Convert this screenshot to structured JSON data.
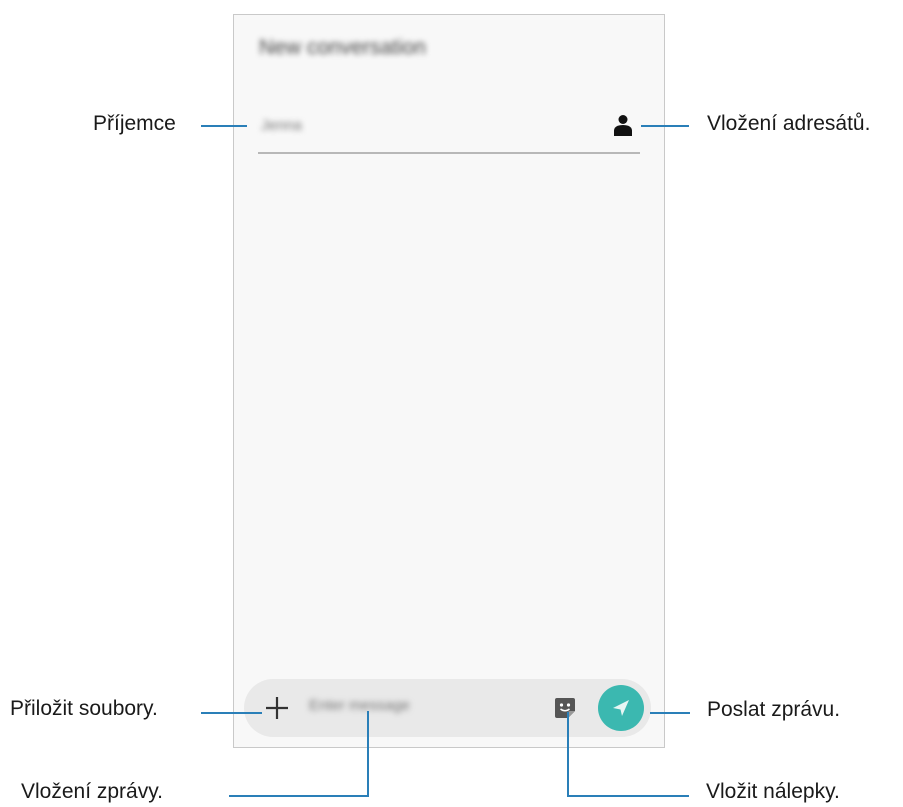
{
  "screen": {
    "title": "New conversation",
    "recipient_placeholder": "Jenna",
    "message_placeholder": "Enter message"
  },
  "icons": {
    "contact": "person-icon",
    "attach": "plus-icon",
    "sticker": "sticker-icon",
    "send": "send-icon"
  },
  "callouts": {
    "recipient": "Příjemce",
    "add_contacts": "Vložení adresátů.",
    "attach_files": "Přiložit soubory.",
    "send_message": "Poslat zprávu.",
    "enter_message": "Vložení zprávy.",
    "insert_stickers": "Vložit nálepky."
  },
  "colors": {
    "send_button": "#3bb8b0",
    "callout_line": "#2a7fb8"
  }
}
